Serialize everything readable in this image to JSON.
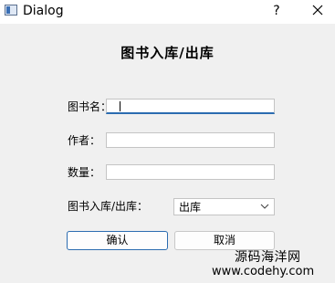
{
  "window": {
    "title": "Dialog",
    "help_label": "?",
    "icons": {
      "app": "app-window-icon",
      "close": "close-icon"
    }
  },
  "form": {
    "heading": "图书入库/出库",
    "book_name": {
      "label": "图书名：",
      "value": ""
    },
    "author": {
      "label": "作者：",
      "value": ""
    },
    "quantity": {
      "label": "数量：",
      "value": ""
    },
    "direction": {
      "label": "图书入库/出库：",
      "selected": "出库"
    }
  },
  "buttons": {
    "confirm": "确认",
    "cancel": "取消"
  },
  "watermark": {
    "name": "源码海洋网",
    "url": "www.codehy.com"
  },
  "colors": {
    "focus_accent": "#2b6cb0",
    "background": "#f0f0f0"
  }
}
